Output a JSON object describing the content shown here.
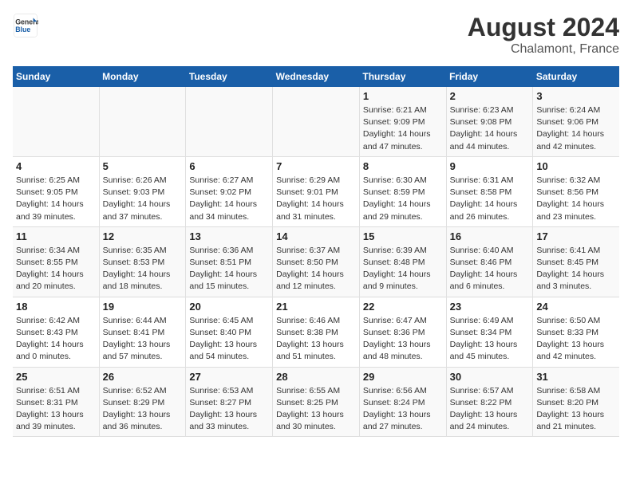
{
  "logo": {
    "line1": "General",
    "line2": "Blue"
  },
  "title": {
    "month_year": "August 2024",
    "location": "Chalamont, France"
  },
  "days_of_week": [
    "Sunday",
    "Monday",
    "Tuesday",
    "Wednesday",
    "Thursday",
    "Friday",
    "Saturday"
  ],
  "weeks": [
    [
      {
        "day": "",
        "detail": ""
      },
      {
        "day": "",
        "detail": ""
      },
      {
        "day": "",
        "detail": ""
      },
      {
        "day": "",
        "detail": ""
      },
      {
        "day": "1",
        "detail": "Sunrise: 6:21 AM\nSunset: 9:09 PM\nDaylight: 14 hours\nand 47 minutes."
      },
      {
        "day": "2",
        "detail": "Sunrise: 6:23 AM\nSunset: 9:08 PM\nDaylight: 14 hours\nand 44 minutes."
      },
      {
        "day": "3",
        "detail": "Sunrise: 6:24 AM\nSunset: 9:06 PM\nDaylight: 14 hours\nand 42 minutes."
      }
    ],
    [
      {
        "day": "4",
        "detail": "Sunrise: 6:25 AM\nSunset: 9:05 PM\nDaylight: 14 hours\nand 39 minutes."
      },
      {
        "day": "5",
        "detail": "Sunrise: 6:26 AM\nSunset: 9:03 PM\nDaylight: 14 hours\nand 37 minutes."
      },
      {
        "day": "6",
        "detail": "Sunrise: 6:27 AM\nSunset: 9:02 PM\nDaylight: 14 hours\nand 34 minutes."
      },
      {
        "day": "7",
        "detail": "Sunrise: 6:29 AM\nSunset: 9:01 PM\nDaylight: 14 hours\nand 31 minutes."
      },
      {
        "day": "8",
        "detail": "Sunrise: 6:30 AM\nSunset: 8:59 PM\nDaylight: 14 hours\nand 29 minutes."
      },
      {
        "day": "9",
        "detail": "Sunrise: 6:31 AM\nSunset: 8:58 PM\nDaylight: 14 hours\nand 26 minutes."
      },
      {
        "day": "10",
        "detail": "Sunrise: 6:32 AM\nSunset: 8:56 PM\nDaylight: 14 hours\nand 23 minutes."
      }
    ],
    [
      {
        "day": "11",
        "detail": "Sunrise: 6:34 AM\nSunset: 8:55 PM\nDaylight: 14 hours\nand 20 minutes."
      },
      {
        "day": "12",
        "detail": "Sunrise: 6:35 AM\nSunset: 8:53 PM\nDaylight: 14 hours\nand 18 minutes."
      },
      {
        "day": "13",
        "detail": "Sunrise: 6:36 AM\nSunset: 8:51 PM\nDaylight: 14 hours\nand 15 minutes."
      },
      {
        "day": "14",
        "detail": "Sunrise: 6:37 AM\nSunset: 8:50 PM\nDaylight: 14 hours\nand 12 minutes."
      },
      {
        "day": "15",
        "detail": "Sunrise: 6:39 AM\nSunset: 8:48 PM\nDaylight: 14 hours\nand 9 minutes."
      },
      {
        "day": "16",
        "detail": "Sunrise: 6:40 AM\nSunset: 8:46 PM\nDaylight: 14 hours\nand 6 minutes."
      },
      {
        "day": "17",
        "detail": "Sunrise: 6:41 AM\nSunset: 8:45 PM\nDaylight: 14 hours\nand 3 minutes."
      }
    ],
    [
      {
        "day": "18",
        "detail": "Sunrise: 6:42 AM\nSunset: 8:43 PM\nDaylight: 14 hours\nand 0 minutes."
      },
      {
        "day": "19",
        "detail": "Sunrise: 6:44 AM\nSunset: 8:41 PM\nDaylight: 13 hours\nand 57 minutes."
      },
      {
        "day": "20",
        "detail": "Sunrise: 6:45 AM\nSunset: 8:40 PM\nDaylight: 13 hours\nand 54 minutes."
      },
      {
        "day": "21",
        "detail": "Sunrise: 6:46 AM\nSunset: 8:38 PM\nDaylight: 13 hours\nand 51 minutes."
      },
      {
        "day": "22",
        "detail": "Sunrise: 6:47 AM\nSunset: 8:36 PM\nDaylight: 13 hours\nand 48 minutes."
      },
      {
        "day": "23",
        "detail": "Sunrise: 6:49 AM\nSunset: 8:34 PM\nDaylight: 13 hours\nand 45 minutes."
      },
      {
        "day": "24",
        "detail": "Sunrise: 6:50 AM\nSunset: 8:33 PM\nDaylight: 13 hours\nand 42 minutes."
      }
    ],
    [
      {
        "day": "25",
        "detail": "Sunrise: 6:51 AM\nSunset: 8:31 PM\nDaylight: 13 hours\nand 39 minutes."
      },
      {
        "day": "26",
        "detail": "Sunrise: 6:52 AM\nSunset: 8:29 PM\nDaylight: 13 hours\nand 36 minutes."
      },
      {
        "day": "27",
        "detail": "Sunrise: 6:53 AM\nSunset: 8:27 PM\nDaylight: 13 hours\nand 33 minutes."
      },
      {
        "day": "28",
        "detail": "Sunrise: 6:55 AM\nSunset: 8:25 PM\nDaylight: 13 hours\nand 30 minutes."
      },
      {
        "day": "29",
        "detail": "Sunrise: 6:56 AM\nSunset: 8:24 PM\nDaylight: 13 hours\nand 27 minutes."
      },
      {
        "day": "30",
        "detail": "Sunrise: 6:57 AM\nSunset: 8:22 PM\nDaylight: 13 hours\nand 24 minutes."
      },
      {
        "day": "31",
        "detail": "Sunrise: 6:58 AM\nSunset: 8:20 PM\nDaylight: 13 hours\nand 21 minutes."
      }
    ]
  ]
}
